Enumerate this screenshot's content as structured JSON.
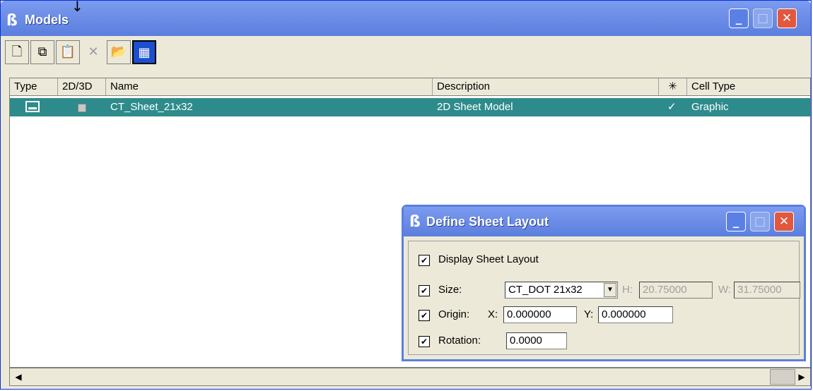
{
  "window": {
    "title": "Models"
  },
  "toolbar": {
    "buttons": [
      {
        "name": "new-model-button",
        "glyph": "🗋"
      },
      {
        "name": "copy-model-button",
        "glyph": "⧉"
      },
      {
        "name": "properties-button",
        "glyph": "📋"
      },
      {
        "name": "delete-button",
        "glyph": "✕"
      },
      {
        "name": "import-button",
        "glyph": "📂"
      },
      {
        "name": "sheet-layout-button",
        "glyph": "▦"
      }
    ]
  },
  "table": {
    "columns": [
      "Type",
      "2D/3D",
      "Name",
      "Description",
      "✳",
      "Cell Type"
    ],
    "rows": [
      {
        "name": "CT_Sheet_21x32",
        "description": "2D Sheet Model",
        "check": "✓",
        "cell_type": "Graphic"
      }
    ]
  },
  "dialog": {
    "title": "Define Sheet Layout",
    "display_label": "Display Sheet Layout",
    "size_label": "Size:",
    "size_value": "CT_DOT 21x32",
    "h_label": "H:",
    "h_value": "20.75000",
    "w_label": "W:",
    "w_value": "31.75000",
    "origin_label": "Origin:",
    "x_label": "X:",
    "x_value": "0.000000",
    "y_label": "Y:",
    "y_value": "0.000000",
    "rotation_label": "Rotation:",
    "rotation_value": "0.0000",
    "check_mark": "✔"
  },
  "scroll": {
    "left": "◀",
    "right": "▶"
  }
}
